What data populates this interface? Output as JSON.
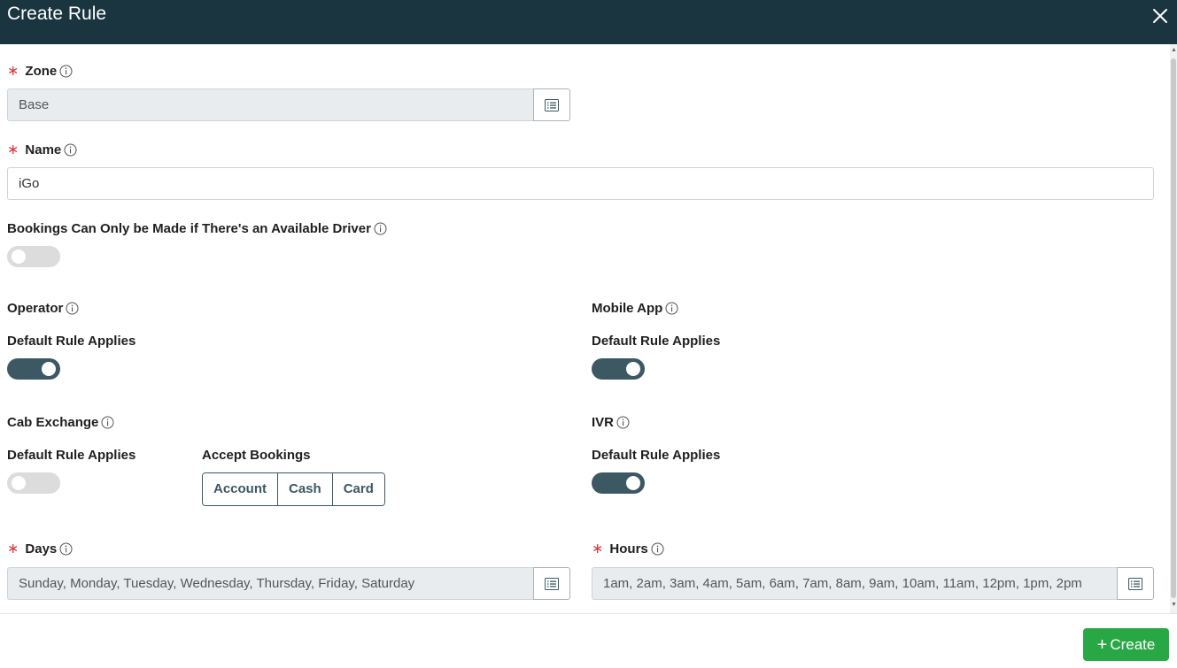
{
  "dialog": {
    "title": "Create Rule"
  },
  "zone": {
    "label": "Zone",
    "value": "Base"
  },
  "name": {
    "label": "Name",
    "value": "iGo"
  },
  "driver_required": {
    "label": "Bookings Can Only be Made if There's an Available Driver",
    "enabled": false
  },
  "operator": {
    "label": "Operator",
    "default_label": "Default Rule Applies",
    "enabled": true
  },
  "mobile_app": {
    "label": "Mobile App",
    "default_label": "Default Rule Applies",
    "enabled": true
  },
  "cab_exchange": {
    "label": "Cab Exchange",
    "default_label": "Default Rule Applies",
    "enabled": false,
    "accept_label": "Accept Bookings",
    "accept_options": [
      "Account",
      "Cash",
      "Card"
    ]
  },
  "ivr": {
    "label": "IVR",
    "default_label": "Default Rule Applies",
    "enabled": true
  },
  "days": {
    "label": "Days",
    "value": "Sunday, Monday, Tuesday, Wednesday, Thursday, Friday, Saturday"
  },
  "hours": {
    "label": "Hours",
    "value": "1am, 2am, 3am, 4am, 5am, 6am, 7am, 8am, 9am, 10am, 11am, 12pm, 1pm, 2pm"
  },
  "footer": {
    "create_label": "Create"
  },
  "colors": {
    "header": "#1a3540",
    "toggle_on": "#3c5863",
    "required": "#e0393e",
    "create": "#28a745"
  }
}
